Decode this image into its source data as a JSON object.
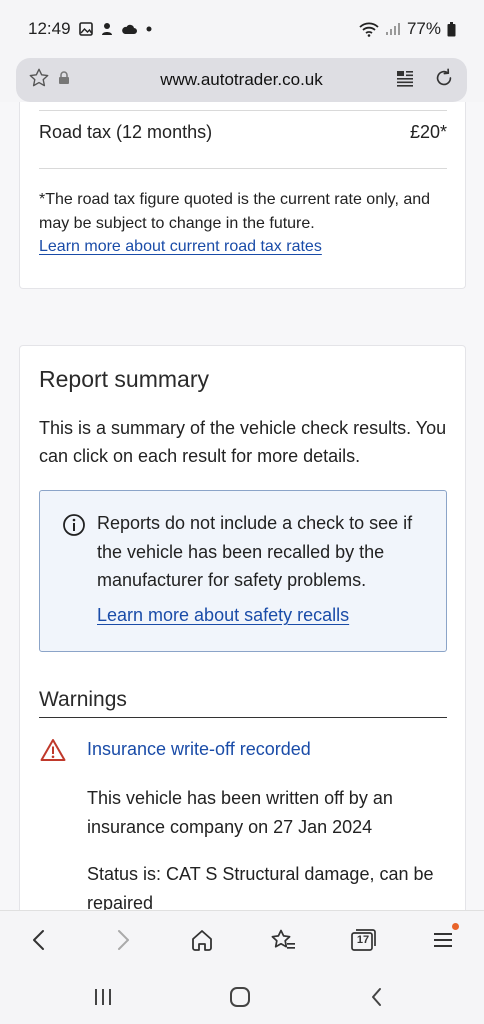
{
  "status_bar": {
    "time": "12:49",
    "battery": "77%"
  },
  "browser": {
    "url": "www.autotrader.co.uk"
  },
  "road_tax": {
    "label": "Road tax (12 months)",
    "value": "£20*",
    "note": "*The road tax figure quoted is the current rate only, and may be subject to change in the future.",
    "link": "Learn more about current road tax rates"
  },
  "report_summary": {
    "title": "Report summary",
    "description": "This is a summary of the vehicle check results. You can click on each result for more details.",
    "info_text": "Reports do not include a check to see if the vehicle has been recalled by the manufacturer for safety problems.",
    "info_link": "Learn more about safety recalls"
  },
  "warnings": {
    "title": "Warnings",
    "item_title": "Insurance write-off recorded",
    "item_desc": "This vehicle has been written off by an insurance company on 27 Jan 2024",
    "item_status": "Status is: CAT S Structural damage, can be repaired"
  },
  "toolbar": {
    "tab_count": "17"
  },
  "colors": {
    "link": "#1a4ca8",
    "warning": "#c0392b",
    "notification_dot": "#e8632a"
  }
}
